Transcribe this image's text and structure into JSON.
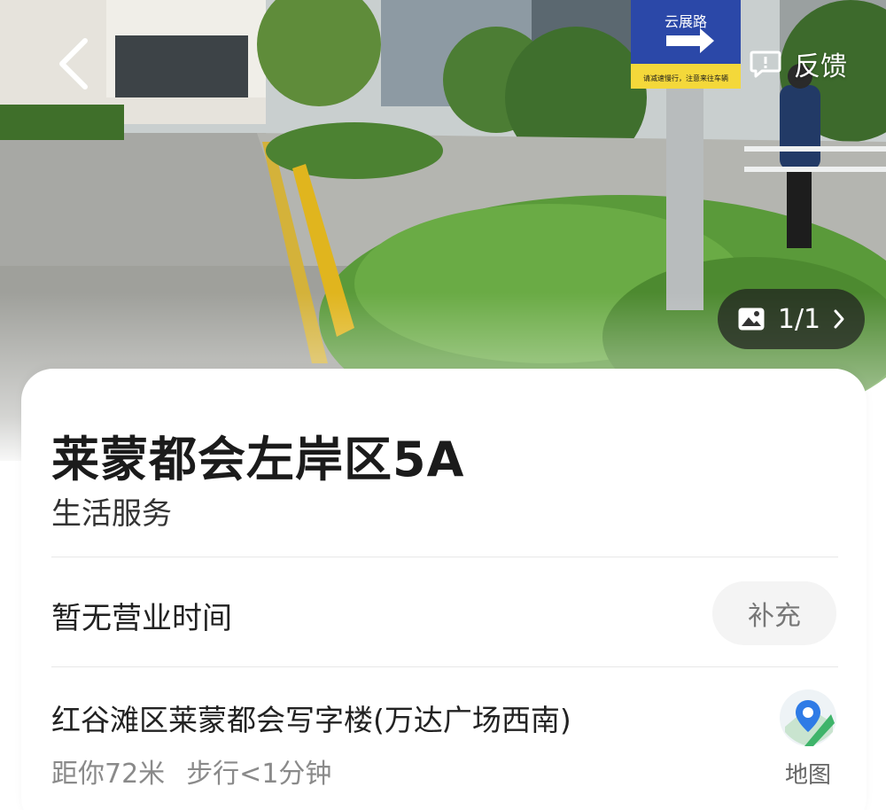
{
  "header": {
    "feedback_label": "反馈",
    "photo_counter": "1/1",
    "icons": {
      "back": "back-arrow-icon",
      "feedback": "feedback-icon",
      "gallery": "image-icon",
      "next": "chevron-right-icon"
    }
  },
  "poi": {
    "name": "莱蒙都会左岸区5A",
    "category": "生活服务",
    "hours_text": "暂无营业时间",
    "supplement_label": "补充",
    "address": "红谷滩区莱蒙都会写字楼(万达广场西南)",
    "distance": "距你72米",
    "walk_time": "步行<1分钟",
    "map_label": "地图"
  },
  "photo": {
    "sign_text": "云展路",
    "sign_subtext": "请减速慢行，注意来往车辆"
  },
  "colors": {
    "accent_blue": "#2f7be6",
    "map_green": "#3fb46a",
    "text_dark": "#1b1b1b",
    "text_gray": "#8a8a8a"
  }
}
